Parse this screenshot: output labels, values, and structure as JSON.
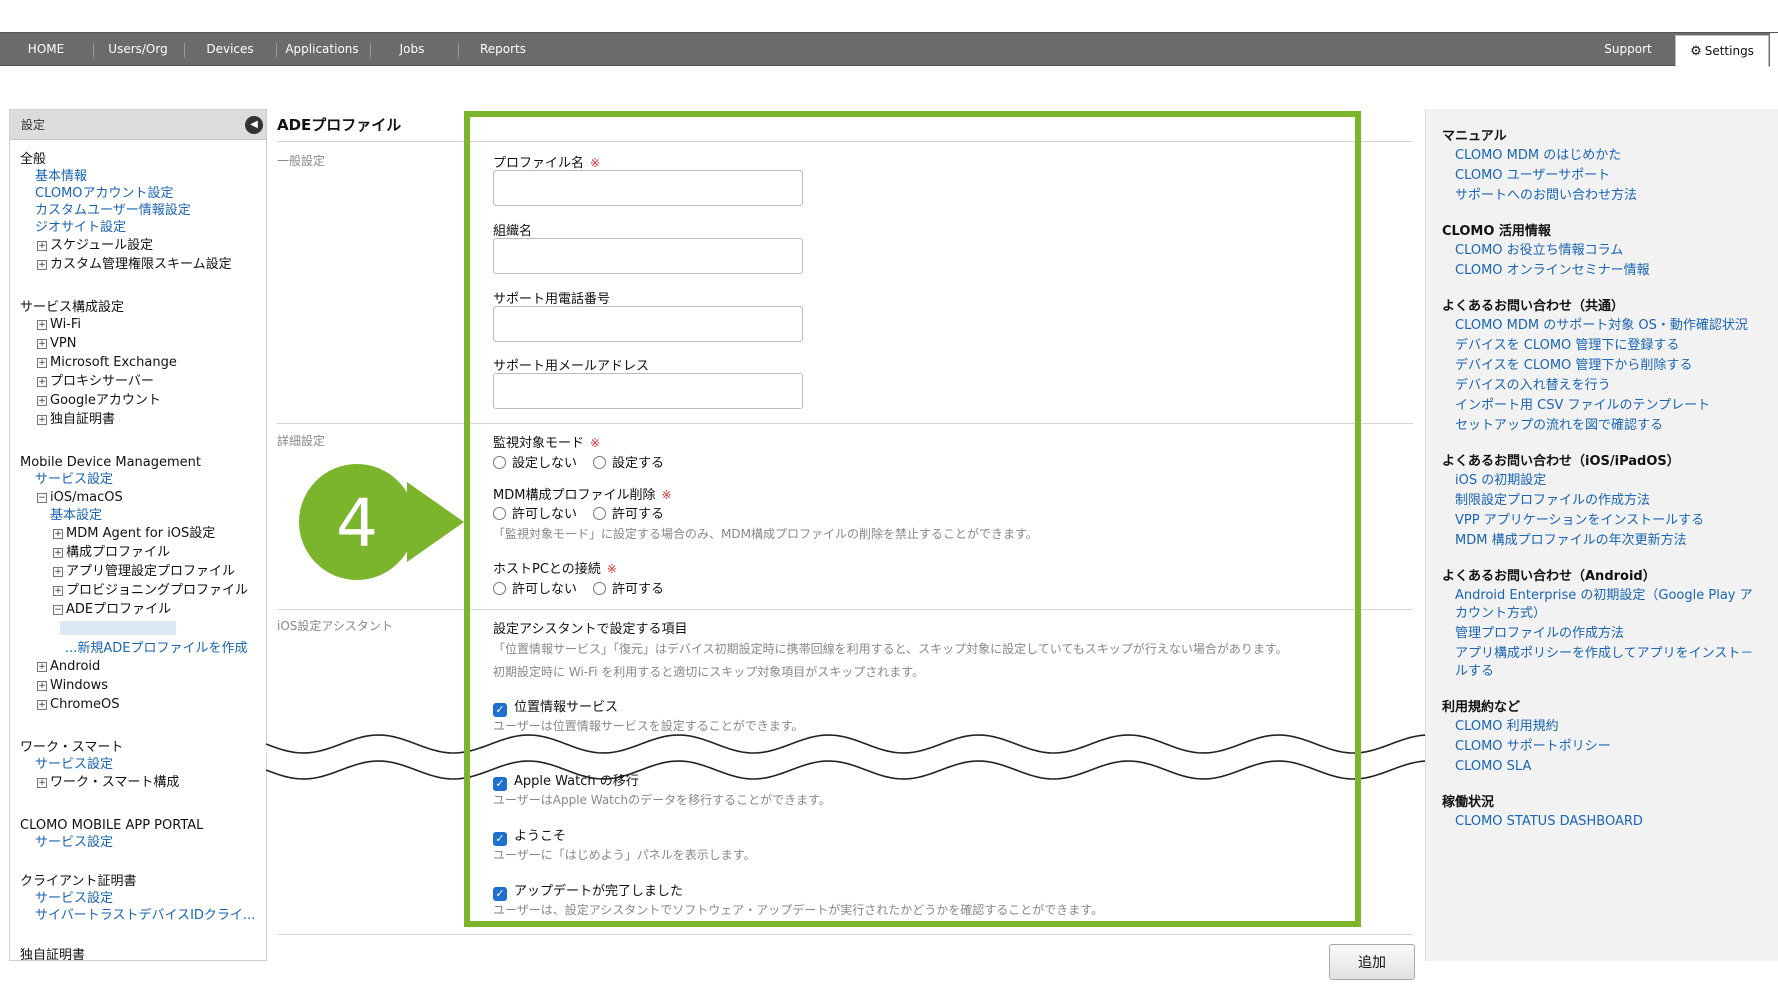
{
  "nav": {
    "items": [
      "HOME",
      "Users/Org",
      "Devices",
      "Applications",
      "Jobs",
      "Reports"
    ],
    "support": "Support",
    "settings": "Settings"
  },
  "sidebar": {
    "title": "設定",
    "general": {
      "heading": "全般",
      "items": [
        "基本情報",
        "CLOMOアカウント設定",
        "カスタムユーザー情報設定",
        "ジオサイト設定"
      ],
      "expandables": [
        "スケジュール設定",
        "カスタム管理権限スキーム設定"
      ]
    },
    "service": {
      "heading": "サービス構成設定",
      "items": [
        "Wi-Fi",
        "VPN",
        "Microsoft Exchange",
        "プロキシサーバー",
        "Googleアカウント",
        "独自証明書"
      ]
    },
    "mdm": {
      "heading": "Mobile Device Management",
      "service_settings": "サービス設定",
      "ios": "iOS/macOS",
      "basic": "基本設定",
      "sub": [
        "MDM Agent for iOS設定",
        "構成プロファイル",
        "アプリ管理設定プロファイル",
        "プロビジョニングプロファイル",
        "ADEプロファイル"
      ],
      "new_ade": "...新規ADEプロファイルを作成",
      "others": [
        "Android",
        "Windows",
        "ChromeOS"
      ]
    },
    "work": {
      "heading": "ワーク・スマート",
      "service_settings": "サービス設定",
      "config": "ワーク・スマート構成"
    },
    "portal": {
      "heading": "CLOMO MOBILE APP PORTAL",
      "service_settings": "サービス設定"
    },
    "client_cert": {
      "heading": "クライアント証明書",
      "service_settings": "サービス設定",
      "cybertrust": "サイバートラストデバイスIDクライ..."
    },
    "own_cert": {
      "heading": "独自証明書"
    }
  },
  "main": {
    "title": "ADEプロファイル",
    "sections": {
      "general": "一般設定",
      "detail": "詳細設定",
      "assistant": "iOS設定アシスタント"
    },
    "fields": {
      "profile_name": "プロファイル名",
      "org_name": "組織名",
      "support_phone": "サポート用電話番号",
      "support_email": "サポート用メールアドレス"
    },
    "required_mark": "※",
    "supervised": {
      "label": "監視対象モード",
      "opt1": "設定しない",
      "opt2": "設定する"
    },
    "mdm_remove": {
      "label": "MDM構成プロファイル削除",
      "opt1": "許可しない",
      "opt2": "許可する",
      "note": "「監視対象モード」に設定する場合のみ、MDM構成プロファイルの削除を禁止することができます。"
    },
    "host_pc": {
      "label": "ホストPCとの接続",
      "opt1": "許可しない",
      "opt2": "許可する"
    },
    "assistant": {
      "heading": "設定アシスタントで設定する項目",
      "note1": "「位置情報サービス」「復元」はデバイス初期設定時に携帯回線を利用すると、スキップ対象に設定していてもスキップが行えない場合があります。",
      "note2": "初期設定時に Wi-Fi を利用すると適切にスキップ対象項目がスキップされます。",
      "items": [
        {
          "label": "位置情報サービス",
          "desc": "ユーザーは位置情報サービスを設定することができます。"
        },
        {
          "label": "Apple Watch の移行",
          "desc": "ユーザーはApple Watchのデータを移行することができます。"
        },
        {
          "label": "ようこそ",
          "desc": "ユーザーに「はじめよう」パネルを表示します。"
        },
        {
          "label": "アップデートが完了しました",
          "desc": "ユーザーは、設定アシスタントでソフトウェア・アップデートが実行されたかどうかを確認することができます。"
        }
      ]
    },
    "add_button": "追加",
    "step_number": "4"
  },
  "right": {
    "manual": {
      "heading": "マニュアル",
      "links": [
        "CLOMO MDM のはじめかた",
        "CLOMO ユーザーサポート",
        "サポートへのお問い合わせ方法"
      ]
    },
    "info": {
      "heading": "CLOMO 活用情報",
      "links": [
        "CLOMO お役立ち情報コラム",
        "CLOMO オンラインセミナー情報"
      ]
    },
    "faq_common": {
      "heading": "よくあるお問い合わせ（共通）",
      "links": [
        "CLOMO MDM のサポート対象 OS・動作確認状況",
        "デバイスを CLOMO 管理下に登録する",
        "デバイスを CLOMO 管理下から削除する",
        "デバイスの入れ替えを行う",
        "インポート用 CSV ファイルのテンプレート",
        "セットアップの流れを図で確認する"
      ]
    },
    "faq_ios": {
      "heading": "よくあるお問い合わせ（iOS/iPadOS）",
      "links": [
        "iOS の初期設定",
        "制限設定プロファイルの作成方法",
        "VPP アプリケーションをインストールする",
        "MDM 構成プロファイルの年次更新方法"
      ]
    },
    "faq_android": {
      "heading": "よくあるお問い合わせ（Android）",
      "link1a": "Android Enterprise の初期設定（Google Play ア",
      "link1b": "カウント方式）",
      "link2": "管理プロファイルの作成方法",
      "link3a": "アプリ構成ポリシーを作成してアプリをインスト－",
      "link3b": "ルする"
    },
    "terms": {
      "heading": "利用規約など",
      "links": [
        "CLOMO 利用規約",
        "CLOMO サポートポリシー",
        "CLOMO SLA"
      ]
    },
    "status": {
      "heading": "稼働状況",
      "link": "CLOMO STATUS DASHBOARD"
    }
  }
}
